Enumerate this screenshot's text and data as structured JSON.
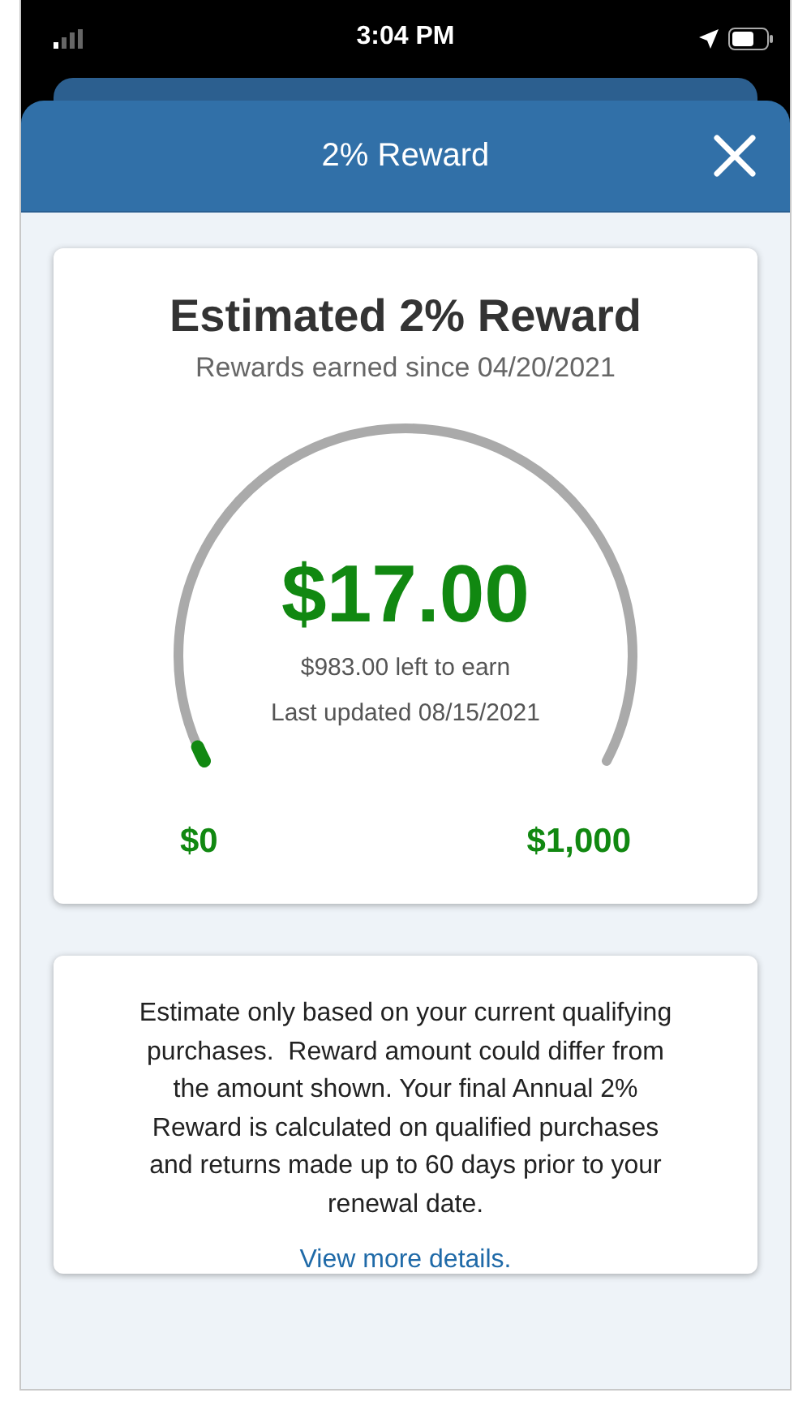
{
  "status_bar": {
    "time": "3:04 PM"
  },
  "header": {
    "title": "2% Reward"
  },
  "reward_card": {
    "title": "Estimated 2% Reward",
    "subtitle": "Rewards earned since 04/20/2021",
    "gauge": {
      "amount": "$17.00",
      "remaining": "$983.00 left to earn",
      "updated": "Last updated 08/15/2021",
      "min_label": "$0",
      "max_label": "$1,000"
    }
  },
  "info_card": {
    "text": "Estimate only based on your current qualifying purchases.  Reward amount could differ from the amount shown. Your final Annual 2% Reward is calculated on qualified purchases and returns made up to 60 days prior to your renewal date.",
    "link": "View more details."
  }
}
